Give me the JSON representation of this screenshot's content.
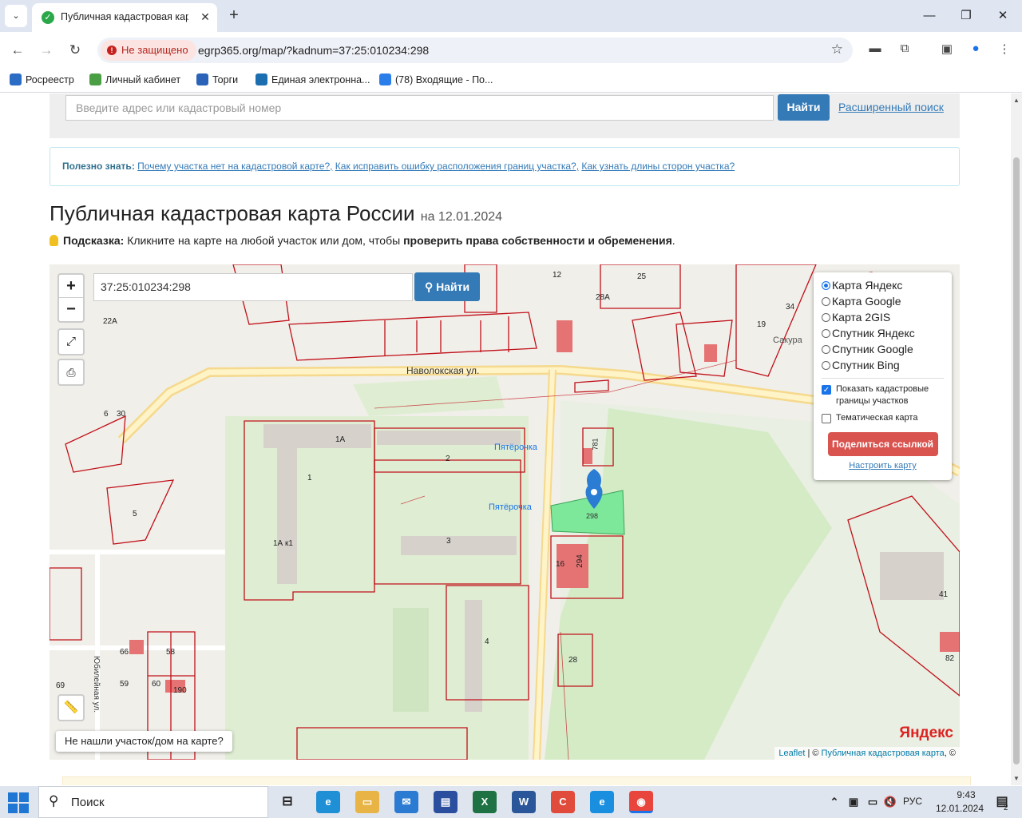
{
  "browser": {
    "tab_title": "Публичная кадастровая карта",
    "security_label": "Не защищено",
    "url": "egrp365.org/map/?kadnum=37:25:010234:298"
  },
  "bookmarks": [
    {
      "label": "Росреестр",
      "color": "#2b6cc4"
    },
    {
      "label": "Личный кабинет",
      "color": "#4a9e43"
    },
    {
      "label": "Торги",
      "color": "#2a63b8"
    },
    {
      "label": "Единая электронна...",
      "color": "#1b6fb0"
    },
    {
      "label": "(78) Входящие - По...",
      "color": "#2b7de9"
    }
  ],
  "search": {
    "placeholder": "Введите адрес или кадастровый номер",
    "button": "Найти",
    "advanced_link": "Расширенный поиск"
  },
  "info": {
    "label": "Полезно знать:",
    "links": [
      "Почему участка нет на кадастровой карте?,",
      "Как исправить ошибку расположения границ участка?,",
      "Как узнать длины сторон участка?"
    ]
  },
  "title": {
    "main": "Публичная кадастровая карта России",
    "date": "на 12.01.2024"
  },
  "hint": {
    "label": "Подсказка:",
    "text": "Кликните на карте на любой участок или дом, чтобы",
    "bold": "проверить права собственности и обременения",
    "end": "."
  },
  "map": {
    "zoom_in": "+",
    "zoom_out": "−",
    "query": "37:25:010234:298",
    "search_button": "Найти",
    "street_label": "Наволокская ул.",
    "street_label_2": "Юбилейная ул.",
    "poi": [
      "Пятёрочка",
      "Пятёрочка",
      "Сакура"
    ],
    "selected_parcel": "298",
    "parcel_labels": [
      "1А",
      "1",
      "2",
      "3",
      "4",
      "16",
      "294",
      "28",
      "781",
      "5",
      "66",
      "58",
      "59",
      "60",
      "190",
      "41",
      "82",
      "19",
      "22А",
      "12",
      "25",
      "28А",
      "34",
      "1А к1",
      "6",
      "30",
      "69"
    ],
    "layers": [
      {
        "label": "Карта Яндекс",
        "selected": true
      },
      {
        "label": "Карта Google",
        "selected": false
      },
      {
        "label": "Карта 2GIS",
        "selected": false
      },
      {
        "label": "Спутник Яндекс",
        "selected": false
      },
      {
        "label": "Спутник Google",
        "selected": false
      },
      {
        "label": "Спутник Bing",
        "selected": false
      }
    ],
    "show_borders_label": "Показать кадастровые границы участков",
    "show_borders": true,
    "thematic_label": "Тематическая карта",
    "thematic": false,
    "share_button": "Поделиться ссылкой",
    "setup_link": "Настроить карту",
    "not_found": "Не нашли участок/дом на карте?",
    "yandex_logo": "Яндекс",
    "attribution_leaflet": "Leaflet",
    "attribution_sep": " | © ",
    "attribution_pkk": "Публичная кадастровая карта",
    "attribution_end": ", ©"
  },
  "taskbar": {
    "search_label": "Поиск",
    "lang": "РУС",
    "time": "9:43",
    "date": "12.01.2024",
    "notifications": "2"
  },
  "colors": {
    "accent": "#337ab7",
    "danger": "#d9534f",
    "parcel_border": "#c0101a",
    "selected_parcel": "#7de89a"
  }
}
